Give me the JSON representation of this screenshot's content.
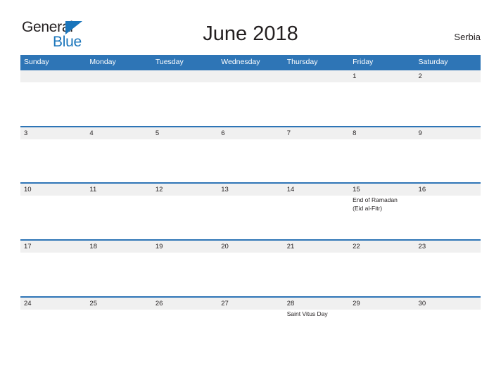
{
  "header": {
    "logo": {
      "word_one": "General",
      "word_two": "Blue",
      "triangle_color": "#1a75bb"
    },
    "title": "June 2018",
    "region": "Serbia"
  },
  "calendar": {
    "accent_color": "#2e75b6",
    "daynum_band_color": "#f0f0f0",
    "weekdays": [
      "Sunday",
      "Monday",
      "Tuesday",
      "Wednesday",
      "Thursday",
      "Friday",
      "Saturday"
    ],
    "weeks": [
      {
        "days": [
          {
            "num": "",
            "event": ""
          },
          {
            "num": "",
            "event": ""
          },
          {
            "num": "",
            "event": ""
          },
          {
            "num": "",
            "event": ""
          },
          {
            "num": "",
            "event": ""
          },
          {
            "num": "1",
            "event": ""
          },
          {
            "num": "2",
            "event": ""
          }
        ]
      },
      {
        "days": [
          {
            "num": "3",
            "event": ""
          },
          {
            "num": "4",
            "event": ""
          },
          {
            "num": "5",
            "event": ""
          },
          {
            "num": "6",
            "event": ""
          },
          {
            "num": "7",
            "event": ""
          },
          {
            "num": "8",
            "event": ""
          },
          {
            "num": "9",
            "event": ""
          }
        ]
      },
      {
        "days": [
          {
            "num": "10",
            "event": ""
          },
          {
            "num": "11",
            "event": ""
          },
          {
            "num": "12",
            "event": ""
          },
          {
            "num": "13",
            "event": ""
          },
          {
            "num": "14",
            "event": ""
          },
          {
            "num": "15",
            "event": "End of Ramadan\n(Eid al-Fitr)"
          },
          {
            "num": "16",
            "event": ""
          }
        ]
      },
      {
        "days": [
          {
            "num": "17",
            "event": ""
          },
          {
            "num": "18",
            "event": ""
          },
          {
            "num": "19",
            "event": ""
          },
          {
            "num": "20",
            "event": ""
          },
          {
            "num": "21",
            "event": ""
          },
          {
            "num": "22",
            "event": ""
          },
          {
            "num": "23",
            "event": ""
          }
        ]
      },
      {
        "days": [
          {
            "num": "24",
            "event": ""
          },
          {
            "num": "25",
            "event": ""
          },
          {
            "num": "26",
            "event": ""
          },
          {
            "num": "27",
            "event": ""
          },
          {
            "num": "28",
            "event": "Saint Vitus Day"
          },
          {
            "num": "29",
            "event": ""
          },
          {
            "num": "30",
            "event": ""
          }
        ]
      }
    ]
  }
}
